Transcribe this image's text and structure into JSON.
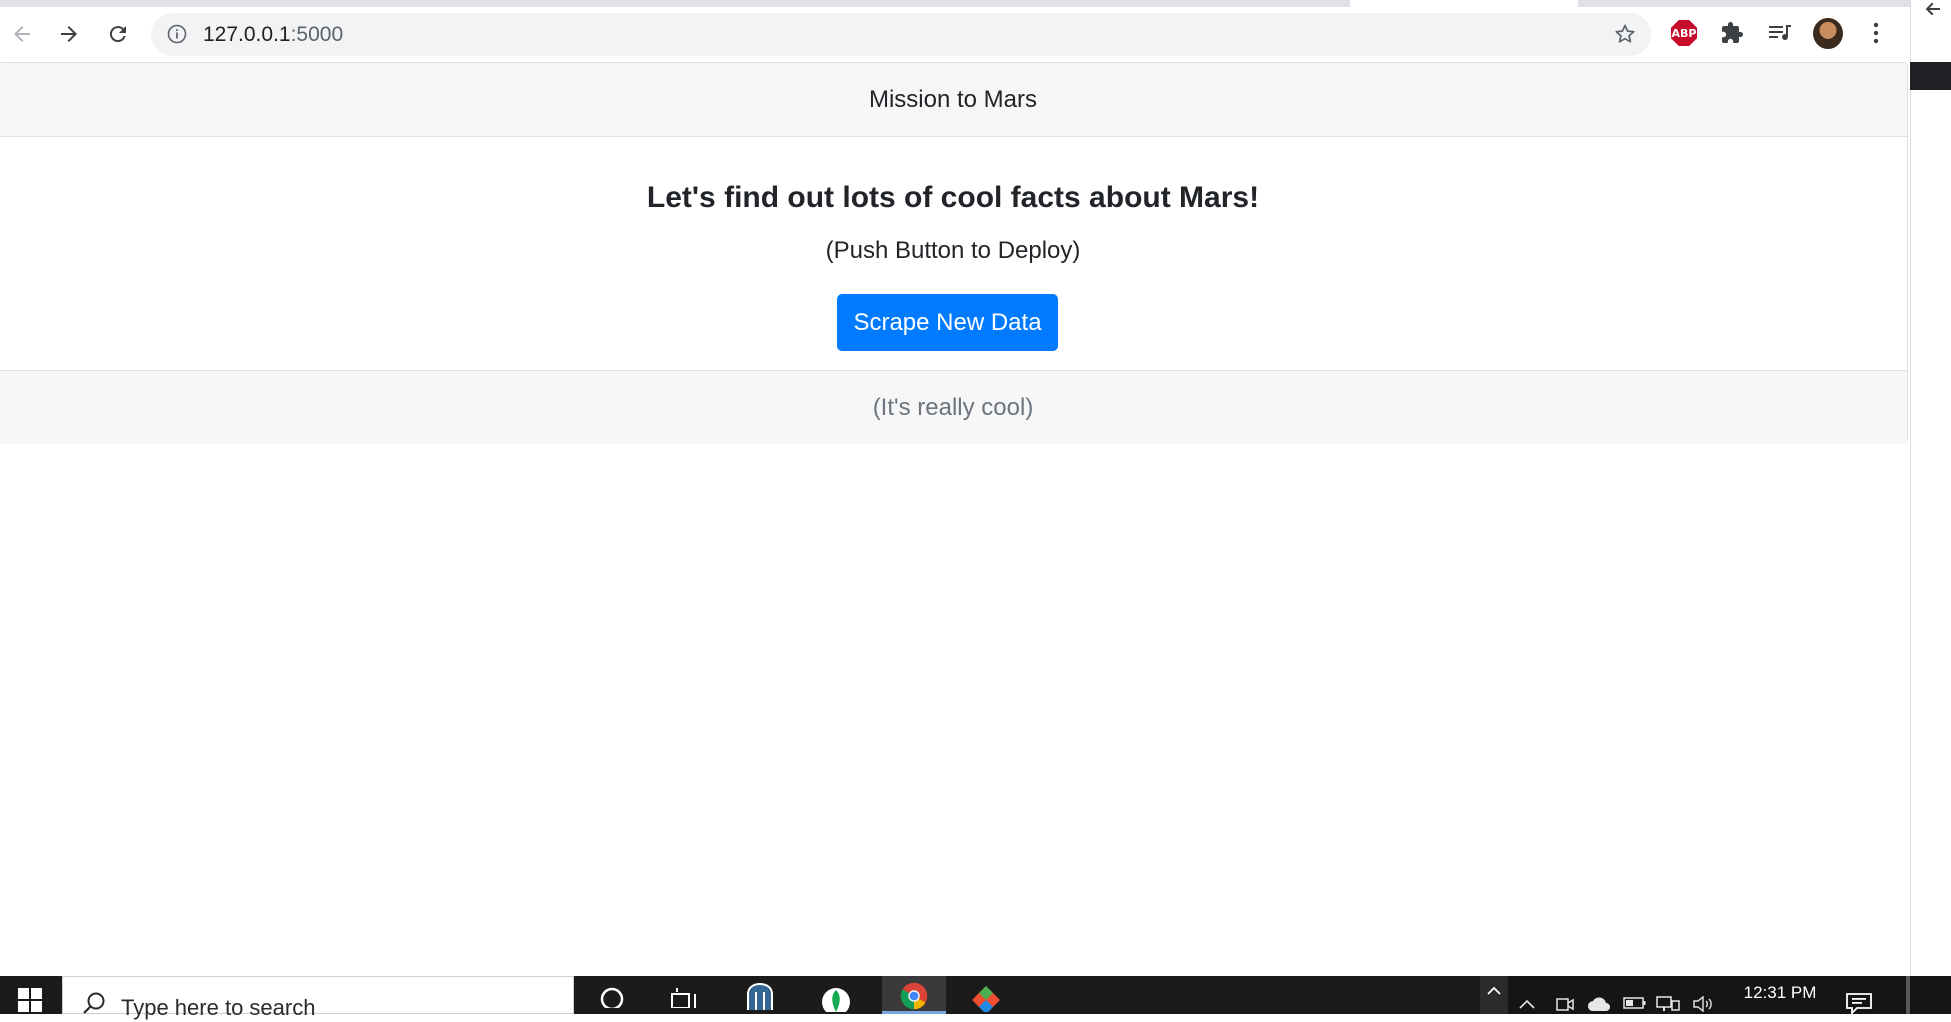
{
  "browser": {
    "url_host": "127.0.0.1",
    "url_port": ":5000",
    "extensions": [
      "ABP"
    ]
  },
  "page": {
    "header": "Mission to Mars",
    "title": "Let's find out lots of cool facts about Mars!",
    "subtitle": "(Push Button to Deploy)",
    "button_label": "Scrape New Data",
    "footer": "(It's really cool)"
  },
  "taskbar": {
    "search_placeholder": "Type here to search",
    "time": "12:31 PM"
  },
  "colors": {
    "accent": "#007bff",
    "header_bg": "#f7f7f7",
    "abp_red": "#c70d2c"
  }
}
